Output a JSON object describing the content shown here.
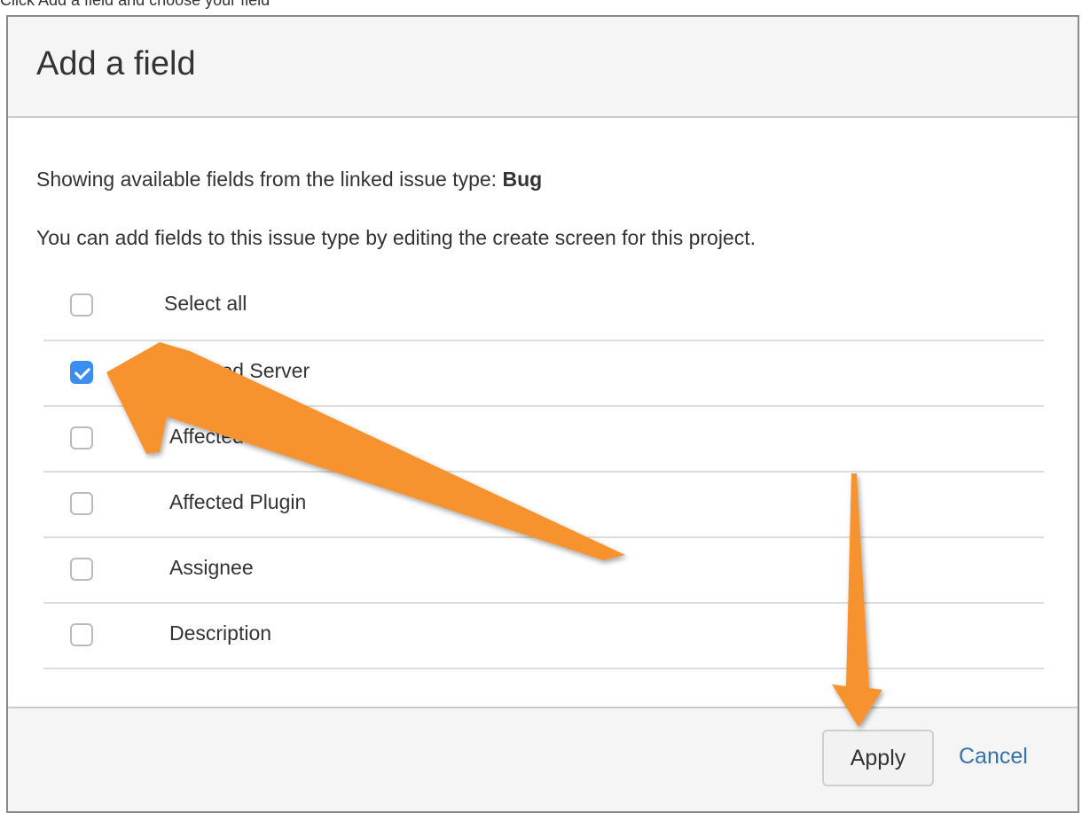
{
  "caption": "Click Add a field and choose your field",
  "dialog": {
    "title": "Add a field",
    "info_prefix": "Showing available fields from the linked issue type: ",
    "issue_type": "Bug",
    "info_secondary": "You can add fields to this issue type by editing the create screen for this project.",
    "select_all_label": "Select all",
    "fields": [
      {
        "label": "Affected Server",
        "checked": true
      },
      {
        "label": "Affected Application",
        "checked": false
      },
      {
        "label": "Affected Plugin",
        "checked": false
      },
      {
        "label": "Assignee",
        "checked": false
      },
      {
        "label": "Description",
        "checked": false
      }
    ],
    "apply_label": "Apply",
    "cancel_label": "Cancel"
  },
  "colors": {
    "accent": "#3b8ef0",
    "link": "#3572b0",
    "annotation_arrow": "#f7932f"
  }
}
